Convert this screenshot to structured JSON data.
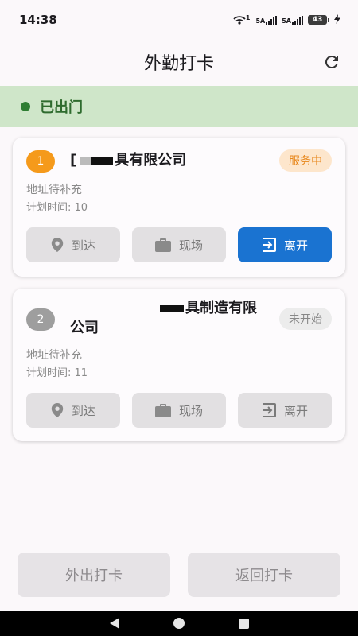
{
  "status_bar": {
    "time": "14:38",
    "network_1": "5A",
    "network_2": "5A",
    "wifi_badge": "1",
    "battery": "43"
  },
  "header": {
    "title": "外勤打卡",
    "refresh_icon": "refresh-icon"
  },
  "status_banner": {
    "text": "已出门",
    "color": "#2e7d32"
  },
  "tasks": [
    {
      "index": "1",
      "title_prefix": "[",
      "title_suffix": "具有限公司",
      "status": "服务中",
      "address": "地址待补充",
      "plan_time": "计划时间: 10",
      "actions": [
        {
          "label": "到达",
          "icon": "location-pin-icon"
        },
        {
          "label": "现场",
          "icon": "briefcase-icon"
        },
        {
          "label": "离开",
          "icon": "exit-icon"
        }
      ]
    },
    {
      "index": "2",
      "title_line1_suffix": "具制造有限",
      "title_line2": "公司",
      "status": "未开始",
      "address": "地址待补充",
      "plan_time": "计划时间: 11",
      "actions": [
        {
          "label": "到达",
          "icon": "location-pin-icon"
        },
        {
          "label": "现场",
          "icon": "briefcase-icon"
        },
        {
          "label": "离开",
          "icon": "exit-icon"
        }
      ]
    }
  ],
  "bottom": {
    "left_label": "外出打卡",
    "right_label": "返回打卡"
  },
  "colors": {
    "primary": "#1a73d1",
    "in_service": "#e8871b",
    "badge_active": "#f59a1b"
  }
}
